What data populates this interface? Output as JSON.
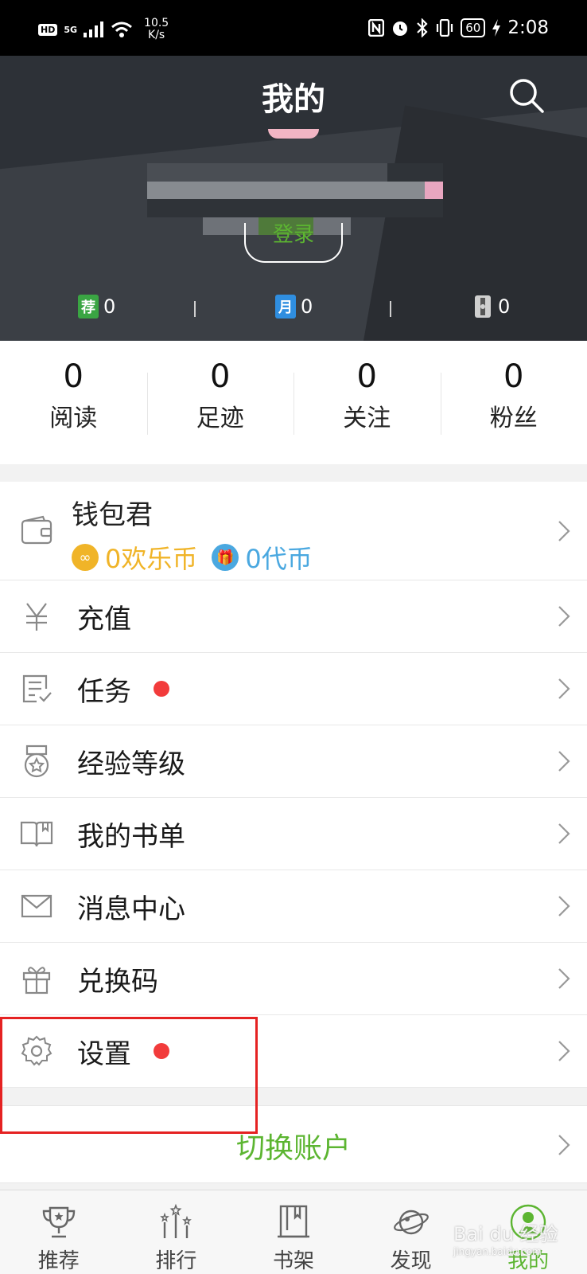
{
  "status_bar": {
    "hd": "HD",
    "network": "5G",
    "speed_value": "10.5",
    "speed_unit": "K/s",
    "battery": "60",
    "time": "2:08"
  },
  "header": {
    "title": "我的",
    "login_label": "登录",
    "stats": [
      {
        "icon_text": "荐",
        "value": "0",
        "color": "#3aa543"
      },
      {
        "icon_text": "月",
        "value": "0",
        "color": "#2f8ee0"
      },
      {
        "icon_text": "",
        "value": "0",
        "color": "#bdbdbd"
      }
    ]
  },
  "counters": [
    {
      "value": "0",
      "label": "阅读"
    },
    {
      "value": "0",
      "label": "足迹"
    },
    {
      "value": "0",
      "label": "关注"
    },
    {
      "value": "0",
      "label": "粉丝"
    }
  ],
  "wallet": {
    "title": "钱包君",
    "happy_coin": "0欢乐币",
    "token_coin": "0代币",
    "happy_color": "#f0b428",
    "token_color": "#4aa8e0"
  },
  "menu": [
    {
      "label": "充值",
      "icon": "yuan-icon",
      "badge": false
    },
    {
      "label": "任务",
      "icon": "task-icon",
      "badge": true
    },
    {
      "label": "经验等级",
      "icon": "medal-icon",
      "badge": false
    },
    {
      "label": "我的书单",
      "icon": "book-icon",
      "badge": false
    },
    {
      "label": "消息中心",
      "icon": "mail-icon",
      "badge": false
    },
    {
      "label": "兑换码",
      "icon": "gift-icon",
      "badge": false
    },
    {
      "label": "设置",
      "icon": "gear-icon",
      "badge": true
    }
  ],
  "switch_account": "切换账户",
  "bottom_nav": [
    {
      "label": "推荐",
      "icon": "trophy-icon",
      "active": false
    },
    {
      "label": "排行",
      "icon": "ranking-icon",
      "active": false
    },
    {
      "label": "书架",
      "icon": "bookshelf-icon",
      "active": false
    },
    {
      "label": "发现",
      "icon": "planet-icon",
      "active": false
    },
    {
      "label": "我的",
      "icon": "profile-icon",
      "active": true
    }
  ],
  "accent_color": "#5cb531",
  "watermark": {
    "main": "Bai du 经验",
    "sub": "jingyan.baidu.com"
  }
}
